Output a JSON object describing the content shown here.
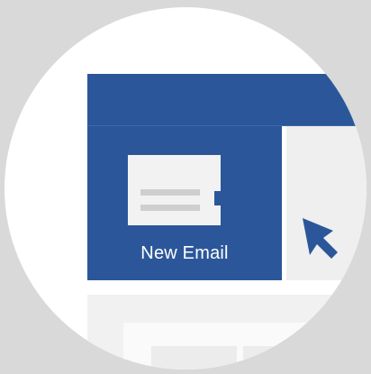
{
  "new_email_button": {
    "label": "New Email"
  },
  "icons": {
    "envelope": "envelope-icon",
    "cursor": "mouse-pointer-icon"
  },
  "colors": {
    "ribbon": "#2b579a",
    "button": "#2b579a",
    "envelope": "#f2f2f2",
    "stamp": "#2b579a",
    "cursor": "#2b579a"
  }
}
